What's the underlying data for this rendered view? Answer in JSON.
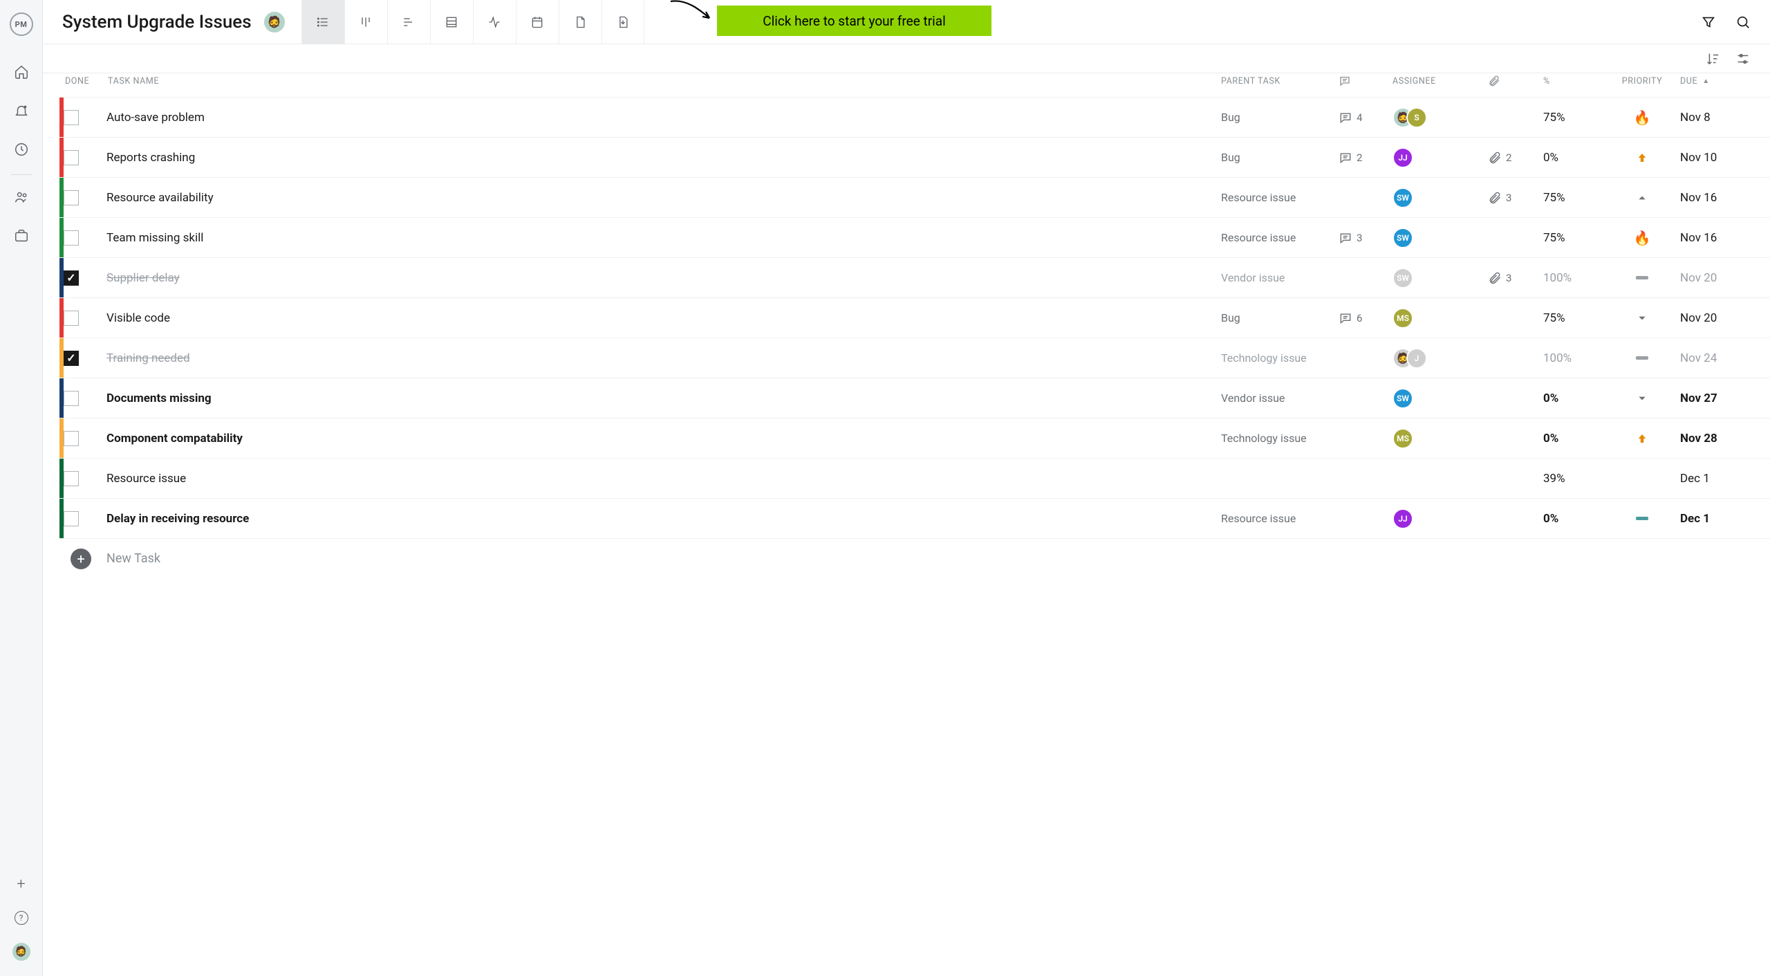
{
  "header": {
    "title": "System Upgrade Issues",
    "trial_cta": "Click here to start your free trial"
  },
  "nav": {
    "logo_text": "PM"
  },
  "columns": {
    "done": "DONE",
    "name": "TASK NAME",
    "parent": "PARENT TASK",
    "assignee": "ASSIGNEE",
    "pct": "%",
    "priority": "PRIORITY",
    "due": "DUE"
  },
  "new_task_placeholder": "New Task",
  "rows": [
    {
      "bar": "red",
      "done": false,
      "name": "Auto-save problem",
      "parent": "Bug",
      "comments": 4,
      "attachments": null,
      "assignees": [
        {
          "cls": "emoji",
          "txt": ""
        },
        {
          "cls": "s",
          "txt": "S"
        }
      ],
      "pct": "75%",
      "priority": "flame",
      "due": "Nov 8",
      "bold": false
    },
    {
      "bar": "red",
      "done": false,
      "name": "Reports crashing",
      "parent": "Bug",
      "comments": 2,
      "attachments": 2,
      "assignees": [
        {
          "cls": "jj",
          "txt": "JJ"
        }
      ],
      "pct": "0%",
      "priority": "up",
      "due": "Nov 10",
      "bold": false
    },
    {
      "bar": "green",
      "done": false,
      "name": "Resource availability",
      "parent": "Resource issue",
      "comments": null,
      "attachments": 3,
      "assignees": [
        {
          "cls": "sw",
          "txt": "SW"
        }
      ],
      "pct": "75%",
      "priority": "caret-up",
      "due": "Nov 16",
      "bold": false
    },
    {
      "bar": "green",
      "done": false,
      "name": "Team missing skill",
      "parent": "Resource issue",
      "comments": 3,
      "attachments": null,
      "assignees": [
        {
          "cls": "sw",
          "txt": "SW"
        }
      ],
      "pct": "75%",
      "priority": "flame",
      "due": "Nov 16",
      "bold": false
    },
    {
      "bar": "navy",
      "done": true,
      "name": "Supplier delay",
      "parent": "Vendor issue",
      "comments": null,
      "attachments": 3,
      "assignees": [
        {
          "cls": "grey",
          "txt": "SW"
        }
      ],
      "pct": "100%",
      "priority": "dash",
      "due": "Nov 20",
      "bold": false
    },
    {
      "bar": "red",
      "done": false,
      "name": "Visible code",
      "parent": "Bug",
      "comments": 6,
      "attachments": null,
      "assignees": [
        {
          "cls": "ms",
          "txt": "MS"
        }
      ],
      "pct": "75%",
      "priority": "caret-down",
      "due": "Nov 20",
      "bold": false
    },
    {
      "bar": "orange",
      "done": true,
      "name": "Training needed",
      "parent": "Technology issue",
      "comments": null,
      "attachments": null,
      "assignees": [
        {
          "cls": "grey emoji",
          "txt": ""
        },
        {
          "cls": "jgrey",
          "txt": "J"
        }
      ],
      "pct": "100%",
      "priority": "dash",
      "due": "Nov 24",
      "bold": false
    },
    {
      "bar": "navy",
      "done": false,
      "name": "Documents missing",
      "parent": "Vendor issue",
      "comments": null,
      "attachments": null,
      "assignees": [
        {
          "cls": "sw",
          "txt": "SW"
        }
      ],
      "pct": "0%",
      "priority": "caret-down",
      "due": "Nov 27",
      "bold": true
    },
    {
      "bar": "orange",
      "done": false,
      "name": "Component compatability",
      "parent": "Technology issue",
      "comments": null,
      "attachments": null,
      "assignees": [
        {
          "cls": "ms",
          "txt": "MS"
        }
      ],
      "pct": "0%",
      "priority": "up",
      "due": "Nov 28",
      "bold": true
    },
    {
      "bar": "dgreen",
      "done": false,
      "name": "Resource issue",
      "parent": "",
      "comments": null,
      "attachments": null,
      "assignees": [],
      "pct": "39%",
      "priority": "",
      "due": "Dec 1",
      "bold": false
    },
    {
      "bar": "dgreen",
      "done": false,
      "name": "Delay in receiving resource",
      "parent": "Resource issue",
      "comments": null,
      "attachments": null,
      "assignees": [
        {
          "cls": "jj",
          "txt": "JJ"
        }
      ],
      "pct": "0%",
      "priority": "dash-teal",
      "due": "Dec 1",
      "bold": true
    }
  ]
}
